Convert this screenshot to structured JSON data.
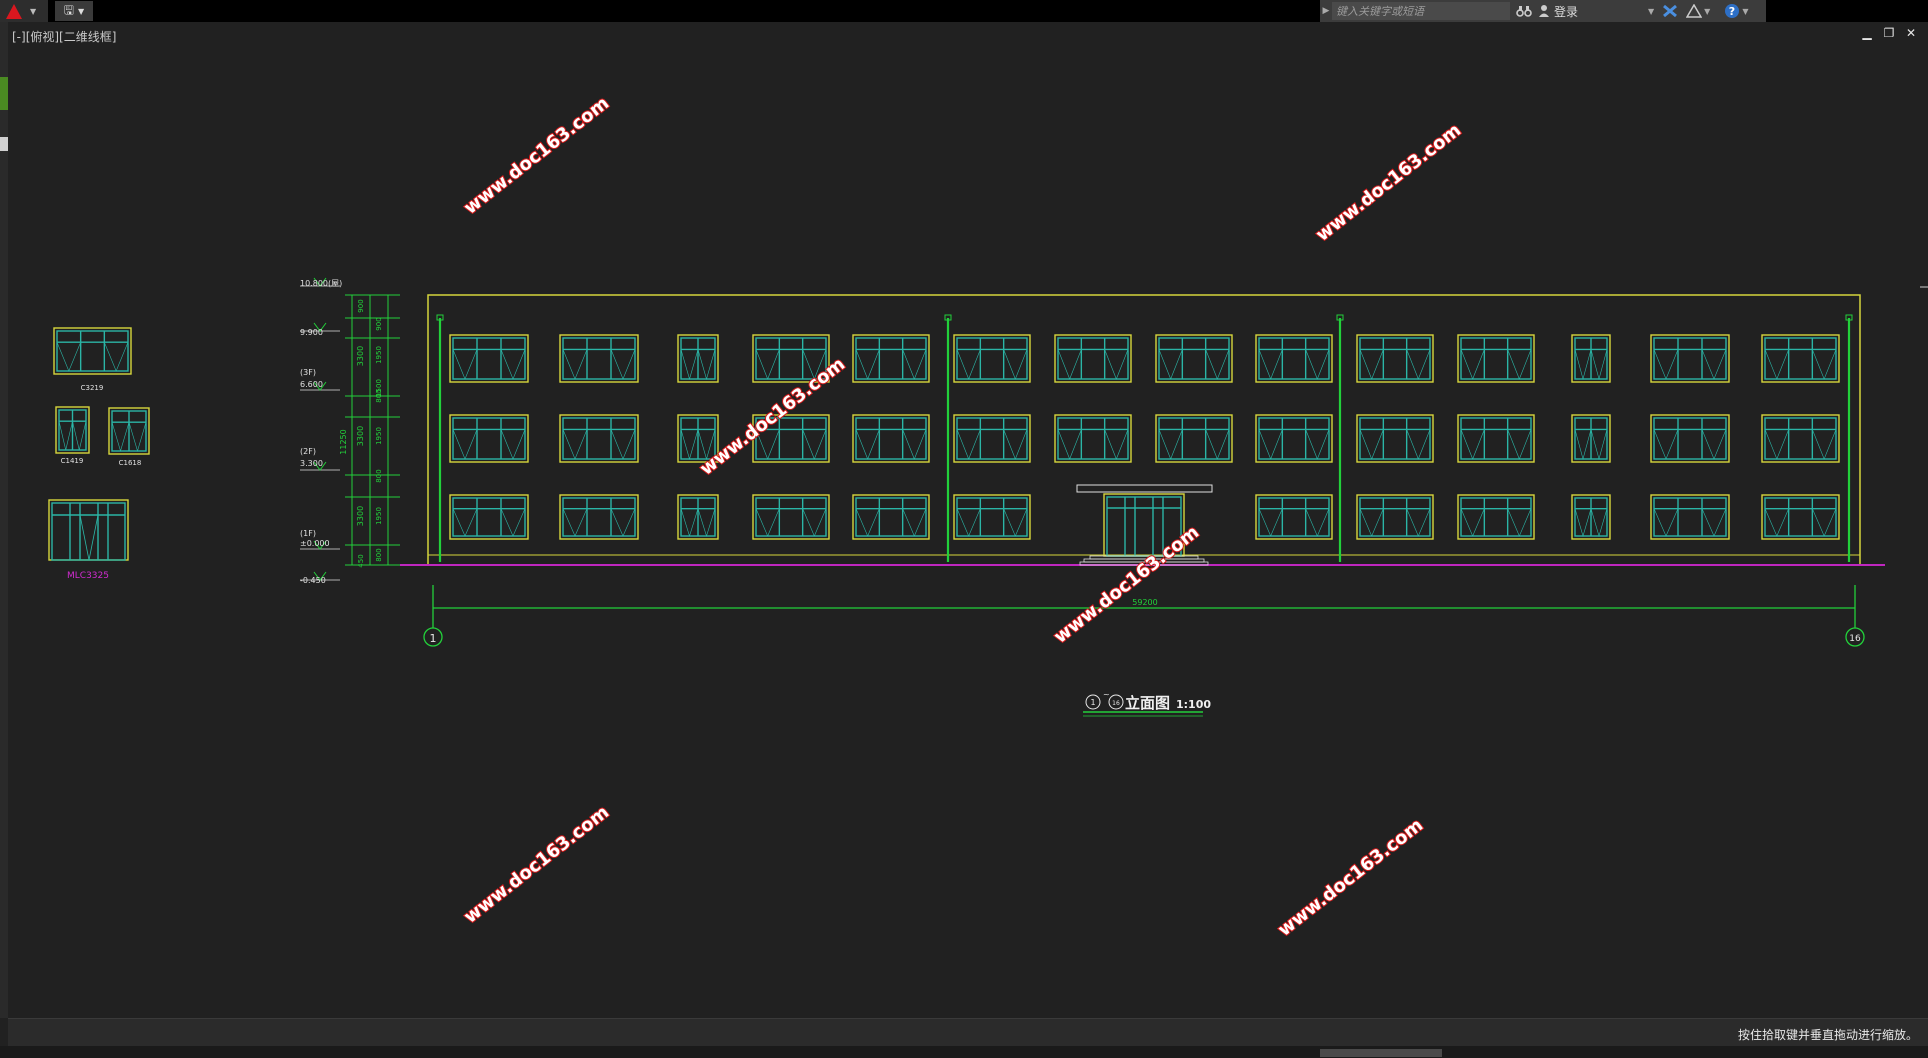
{
  "title_bar": {
    "search_placeholder": "键入关键字或短语",
    "sign_in_label": "登录"
  },
  "viewport": {
    "label": "[-][俯视][二维线框]"
  },
  "drawing": {
    "elevation_marks": [
      "10.800(屋)",
      "9.900",
      "(3F)",
      "6.600",
      "(2F)",
      "3.300",
      "(1F)",
      "±0.000",
      "-0.450"
    ],
    "dimension_total_vertical": "11250",
    "dimension_floor_heights": [
      "3300",
      "3300",
      "3300",
      "900",
      "450"
    ],
    "dimension_segments": [
      "900",
      "1950",
      "1950",
      "1950",
      "800",
      "800",
      "800",
      "1500"
    ],
    "total_width": "59200",
    "axis_start": "1",
    "axis_end": "16",
    "title_axis_a": "1",
    "title_axis_b": "16",
    "title_text": "立面图",
    "title_scale": "1:100",
    "legend_labels": [
      "C3219",
      "C1419",
      "C1618",
      "MLC3325"
    ],
    "watermark": "www.doc163.com"
  },
  "status_bar": {
    "message": "按住拾取键并垂直拖动进行缩放。"
  },
  "colors": {
    "background": "#212121",
    "frame_yellow": "#d6d63c",
    "window_cyan": "#2bb5a6",
    "dim_green": "#22d03a",
    "ground_magenta": "#c027c0",
    "watermark_red": "#d81b1b",
    "logo_red": "#d9171f"
  }
}
